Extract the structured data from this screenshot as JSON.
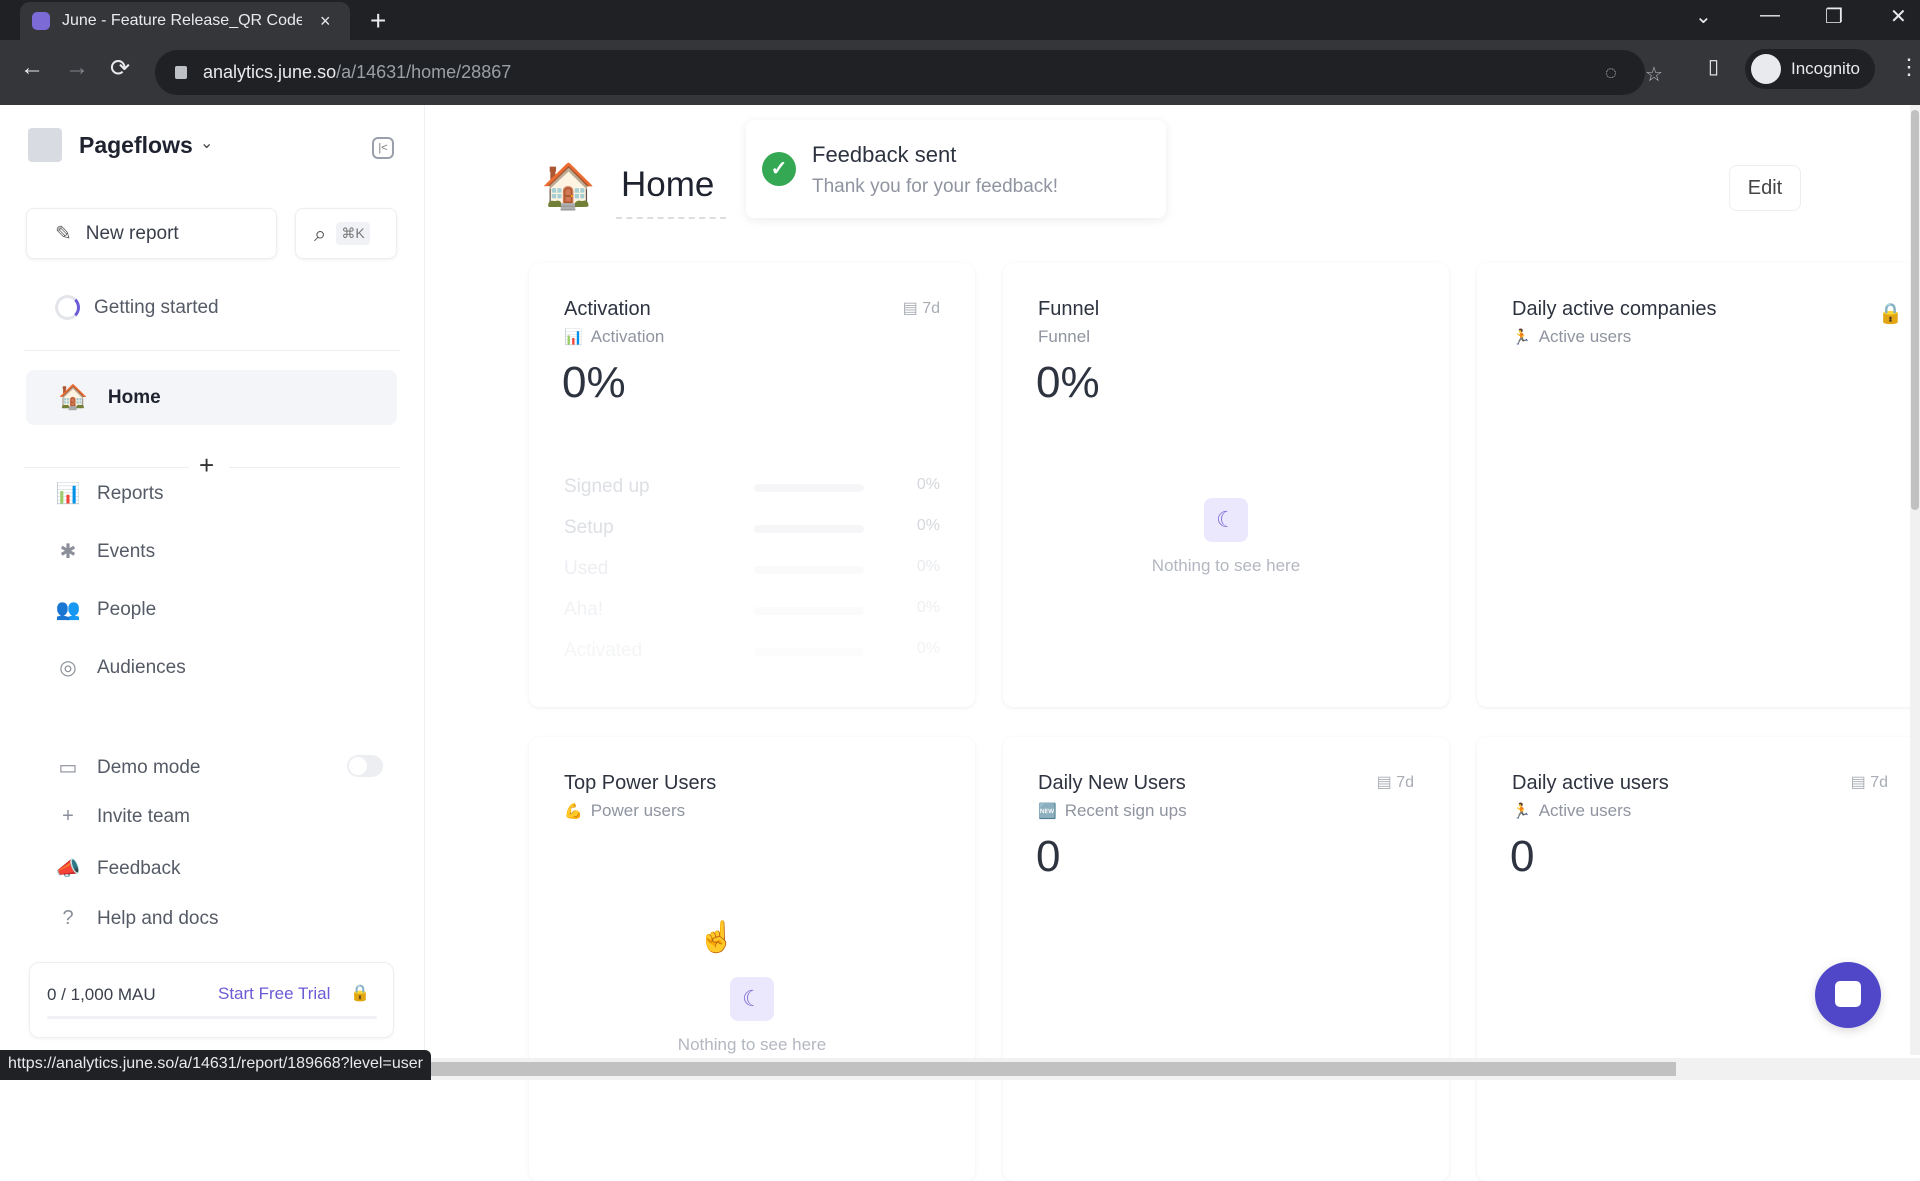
{
  "browser": {
    "tab_title": "June - Feature Release_QR Code",
    "tab_close": "×",
    "new_tab": "+",
    "url_host": "analytics.june.so",
    "url_path": "/a/14631/home/28867",
    "profile_label": "Incognito",
    "status_url": "https://analytics.june.so/a/14631/report/189668?level=user",
    "icons": {
      "back": "←",
      "forward": "→",
      "reload": "⟳",
      "eye_off": "◌",
      "star": "☆",
      "sidepanel": "▯",
      "menu": "⋮",
      "minimize": "—",
      "restore": "❐",
      "close": "✕",
      "tabsearch": "⌄"
    }
  },
  "sidebar": {
    "workspace_name": "Pageflows",
    "workspace_chevron": "⌄",
    "collapse_icon": "|<",
    "new_report_label": "New report",
    "new_report_icon": "✎",
    "search_icon": "⌕",
    "search_shortcut": "⌘K",
    "getting_started_label": "Getting started",
    "home_label": "Home",
    "home_icon": "🏠",
    "add_icon": "+",
    "nav_items": [
      {
        "label": "Reports",
        "icon": "📊"
      },
      {
        "label": "Events",
        "icon": "✱"
      },
      {
        "label": "People",
        "icon": "👥"
      },
      {
        "label": "Audiences",
        "icon": "◎"
      }
    ],
    "bottom_items": [
      {
        "label": "Demo mode",
        "icon": "▭"
      },
      {
        "label": "Invite team",
        "icon": "+"
      },
      {
        "label": "Feedback",
        "icon": "📣"
      },
      {
        "label": "Help and docs",
        "icon": "?"
      }
    ],
    "demo_mode_on": false,
    "mau": {
      "count": "0 / 1,000 MAU",
      "trial_label": "Start Free Trial",
      "lock_icon": "🔒",
      "usage_fraction": 0
    }
  },
  "main": {
    "page_icon": "🏠",
    "page_title": "Home",
    "edit_label": "Edit",
    "toast": {
      "title": "Feedback sent",
      "message": "Thank you for your feedback!",
      "icon": "✓"
    },
    "cards": [
      {
        "title": "Activation",
        "subtitle": "Activation",
        "subtitle_icon": "📊",
        "range": "▤ 7d",
        "value": "0%",
        "funnel_rows": [
          {
            "label": "Signed up",
            "pct": "0%",
            "fraction": 0
          },
          {
            "label": "Setup",
            "pct": "0%",
            "fraction": 0
          },
          {
            "label": "Used",
            "pct": "0%",
            "fraction": 0
          },
          {
            "label": "Aha!",
            "pct": "0%",
            "fraction": 0
          },
          {
            "label": "Activated",
            "pct": "0%",
            "fraction": 0
          }
        ]
      },
      {
        "title": "Funnel",
        "subtitle": "Funnel",
        "value": "0%",
        "empty_text": "Nothing to see here",
        "empty_icon": "☾"
      },
      {
        "title": "Daily active companies",
        "subtitle": "Active users",
        "subtitle_icon": "🏃",
        "lock_icon": "🔒"
      },
      {
        "title": "Top Power Users",
        "subtitle": "Power users",
        "subtitle_icon": "💪",
        "empty_text": "Nothing to see here",
        "empty_icon": "☾"
      },
      {
        "title": "Daily New Users",
        "subtitle": "Recent sign ups",
        "subtitle_icon": "🆕",
        "range": "▤ 7d",
        "value": "0"
      },
      {
        "title": "Daily active users",
        "subtitle": "Active users",
        "subtitle_icon": "🏃",
        "range": "▤ 7d",
        "value": "0"
      }
    ]
  }
}
